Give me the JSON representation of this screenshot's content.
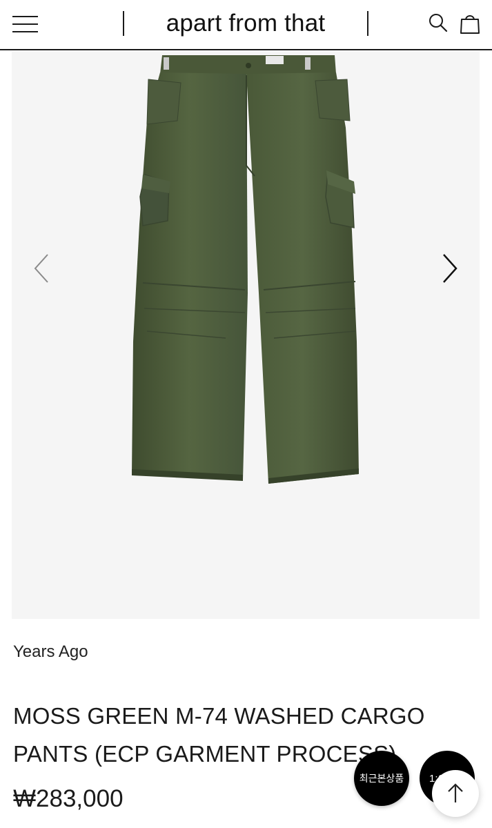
{
  "header": {
    "brand": "apart from that",
    "menu_icon": "hamburger-menu-icon",
    "search_icon": "search-icon",
    "cart_icon": "shopping-bag-icon"
  },
  "gallery": {
    "image_alt": "moss green cargo pants",
    "product_color": "#4b5a38",
    "background": "#f5f5f5",
    "prev_icon": "chevron-left-icon",
    "next_icon": "chevron-right-icon"
  },
  "product": {
    "brand": "Years Ago",
    "title_line1": "MOSS GREEN M-74 WASHED CARGO",
    "title_line2": "PANTS (ECP GARMENT PROCESS)",
    "price": "₩283,000"
  },
  "floating": {
    "recent_label": "최근본상품",
    "chat_label": "1:1",
    "top_icon": "arrow-up-icon"
  }
}
